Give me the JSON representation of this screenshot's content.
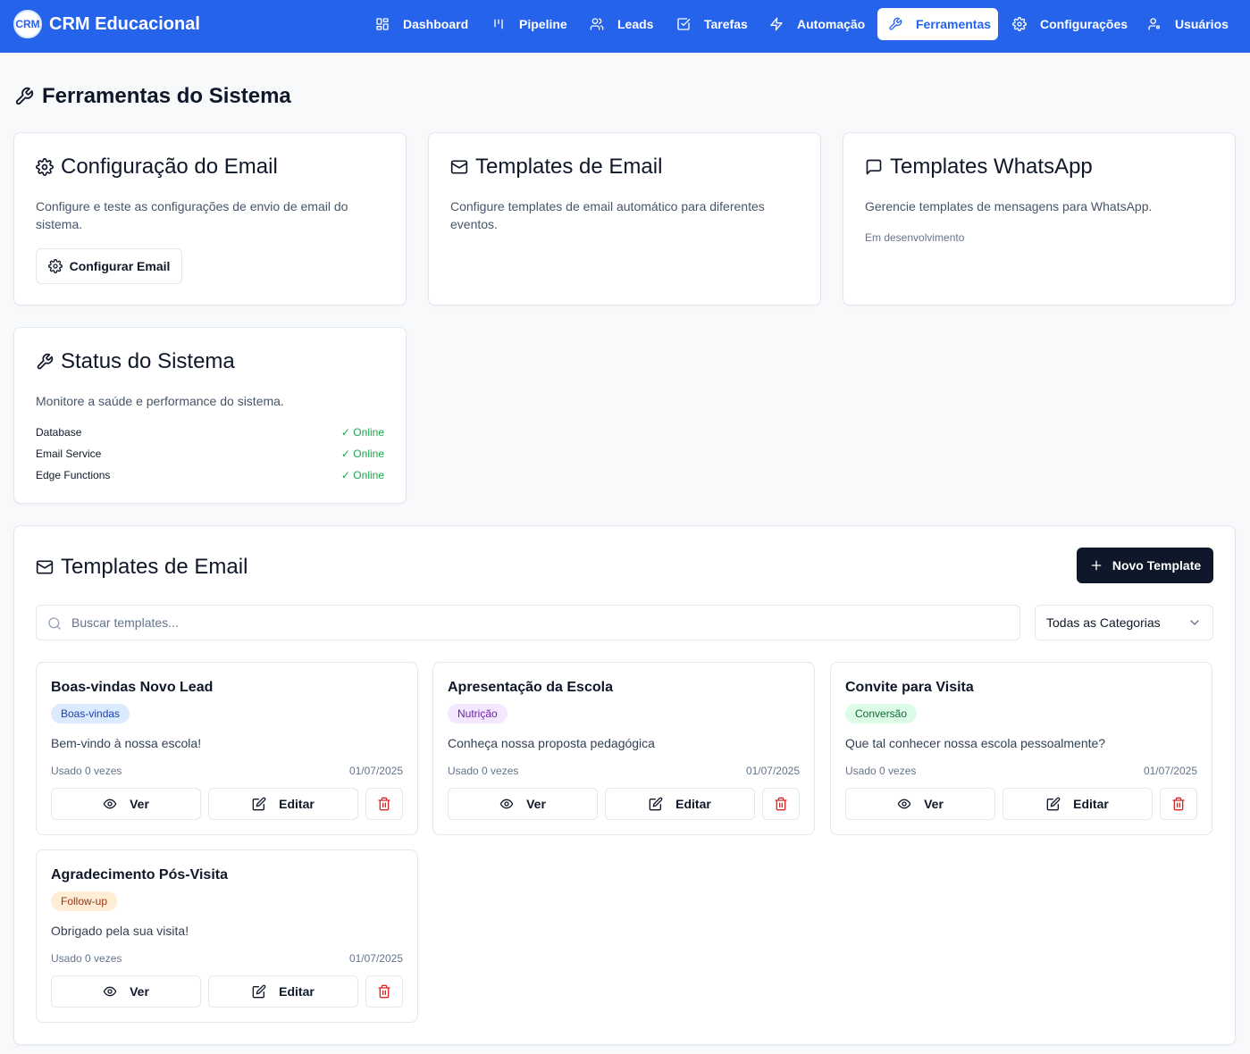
{
  "app": {
    "logo_text": "CRM",
    "name": "CRM Educacional"
  },
  "nav": {
    "items": [
      {
        "label": "Dashboard",
        "icon": "dashboard-icon"
      },
      {
        "label": "Pipeline",
        "icon": "pipeline-icon"
      },
      {
        "label": "Leads",
        "icon": "users-icon"
      },
      {
        "label": "Tarefas",
        "icon": "checkbox-icon"
      },
      {
        "label": "Automação",
        "icon": "lightning-icon"
      },
      {
        "label": "Ferramentas",
        "icon": "wrench-icon",
        "active": true
      },
      {
        "label": "Configurações",
        "icon": "gear-icon"
      },
      {
        "label": "Usuários",
        "icon": "user-icon"
      }
    ]
  },
  "page": {
    "title": "Ferramentas do Sistema"
  },
  "tools": {
    "email_config": {
      "title": "Configuração do Email",
      "description": "Configure e teste as configurações de envio de email do sistema.",
      "button": "Configurar Email"
    },
    "email_templates": {
      "title": "Templates de Email",
      "description": "Configure templates de email automático para diferentes eventos."
    },
    "whatsapp_templates": {
      "title": "Templates WhatsApp",
      "description": "Gerencie templates de mensagens para WhatsApp.",
      "note": "Em desenvolvimento"
    },
    "system_status": {
      "title": "Status do Sistema",
      "description": "Monitore a saúde e performance do sistema.",
      "services": [
        {
          "name": "Database",
          "status": "✓ Online"
        },
        {
          "name": "Email Service",
          "status": "✓ Online"
        },
        {
          "name": "Edge Functions",
          "status": "✓ Online"
        }
      ]
    }
  },
  "templates_section": {
    "title": "Templates de Email",
    "new_button": "Novo Template",
    "search_placeholder": "Buscar templates...",
    "category_filter": "Todas as Categorias",
    "view_label": "Ver",
    "edit_label": "Editar",
    "templates": [
      {
        "name": "Boas-vindas Novo Lead",
        "category": "Boas-vindas",
        "subject": "Bem-vindo à nossa escola!",
        "usage": "Usado 0 vezes",
        "date": "01/07/2025"
      },
      {
        "name": "Apresentação da Escola",
        "category": "Nutrição",
        "subject": "Conheça nossa proposta pedagógica",
        "usage": "Usado 0 vezes",
        "date": "01/07/2025"
      },
      {
        "name": "Convite para Visita",
        "category": "Conversão",
        "subject": "Que tal conhecer nossa escola pessoalmente?",
        "usage": "Usado 0 vezes",
        "date": "01/07/2025"
      },
      {
        "name": "Agradecimento Pós-Visita",
        "category": "Follow-up",
        "subject": "Obrigado pela sua visita!",
        "usage": "Usado 0 vezes",
        "date": "01/07/2025"
      }
    ]
  },
  "colors": {
    "primary": "#2563eb",
    "dark_button": "#0f172a",
    "status_online": "#16a34a",
    "delete": "#dc2626",
    "badge_boas_vindas": "#dbeafe",
    "badge_nutricao": "#f3e8ff",
    "badge_conversao": "#dcfce7",
    "badge_follow_up": "#ffedd5"
  }
}
